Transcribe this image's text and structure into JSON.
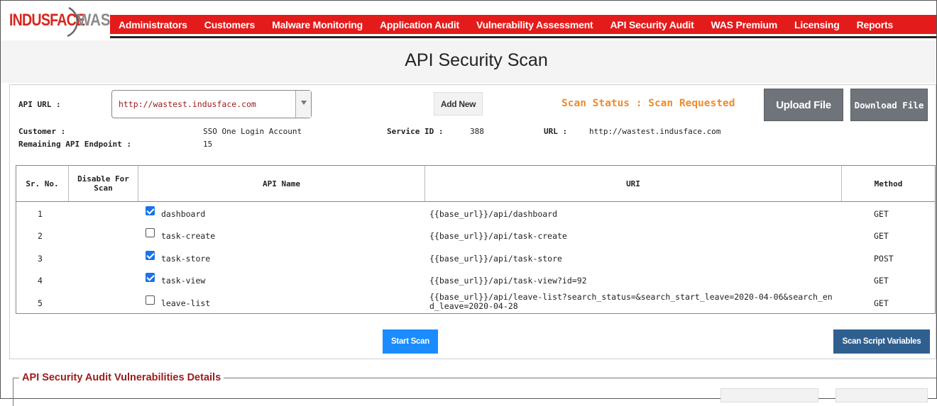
{
  "brand": {
    "logo_text": "INDUSFACE",
    "logo_suffix": "WAS",
    "logo_red": "#d7261e",
    "logo_grey": "#8a8a8a"
  },
  "nav": {
    "items": [
      "Administrators",
      "Customers",
      "Malware Monitoring",
      "Application Audit",
      "Vulnerability Assessment",
      "API Security Audit",
      "WAS Premium",
      "Licensing",
      "Reports"
    ],
    "bg_color": "#e41b1b"
  },
  "page": {
    "title": "API Security Scan"
  },
  "scan": {
    "api_url_label": "API URL :",
    "api_url_value": "http://wastest.indusface.com",
    "add_new_label": "Add New",
    "status_text": "Scan Status : Scan Requested",
    "upload_label": "Upload File",
    "download_label": "Download File",
    "customer_label": "Customer :",
    "customer_value": "SSO One Login Account",
    "remaining_label": "Remaining API Endpoint :",
    "remaining_value": "15",
    "service_id_label": "Service ID :",
    "service_id_value": "388",
    "url_label": "URL :",
    "url_value": "http://wastest.indusface.com"
  },
  "table": {
    "headers": {
      "sr_no": "Sr. No.",
      "disable": "Disable For Scan",
      "api_name": "API Name",
      "uri": "URI",
      "method": "Method"
    },
    "rows": [
      {
        "sr": "1",
        "checked": true,
        "name": "dashboard",
        "uri": "{{base_url}}/api/dashboard",
        "method": "GET"
      },
      {
        "sr": "2",
        "checked": false,
        "name": "task-create",
        "uri": "{{base_url}}/api/task-create",
        "method": "GET"
      },
      {
        "sr": "3",
        "checked": true,
        "name": "task-store",
        "uri": "{{base_url}}/api/task-store",
        "method": "POST"
      },
      {
        "sr": "4",
        "checked": true,
        "name": "task-view",
        "uri": "{{base_url}}/api/task-view?id=92",
        "method": "GET"
      },
      {
        "sr": "5",
        "checked": false,
        "name": "leave-list",
        "uri": "{{base_url}}/api/leave-list?search_status=&search_start_leave=2020-04-06&search_end_leave=2020-04-28",
        "method": "GET"
      }
    ]
  },
  "actions": {
    "start_scan_label": "Start Scan",
    "scan_vars_label": "Scan Script Variables"
  },
  "vulnerabilities": {
    "legend": "API Security Audit Vulnerabilities Details"
  }
}
